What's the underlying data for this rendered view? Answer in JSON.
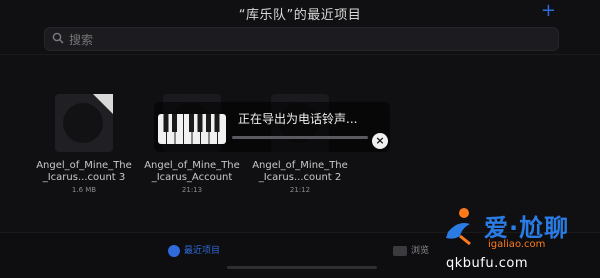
{
  "header": {
    "title": "“库乐队”的最近项目",
    "add_label": "+"
  },
  "search": {
    "placeholder": "搜索"
  },
  "files": [
    {
      "name": "Angel_of_Mine_The_Icarus...count 3",
      "meta": "1.6 MB"
    },
    {
      "name": "Angel_of_Mine_The_Icarus_Account",
      "meta": "21:13"
    },
    {
      "name": "Angel_of_Mine_The_Icarus...count 2",
      "meta": "21:12"
    }
  ],
  "overlay": {
    "message": "正在导出为电话铃声...",
    "close_label": "×"
  },
  "tabbar": {
    "recent_label": "最近项目",
    "browse_label": "浏览"
  },
  "watermark": {
    "brand": "爱·尬聊",
    "site_cn": "igaliao.com",
    "site_en": "qkbufu.com"
  },
  "colors": {
    "accent": "#2f6bdc",
    "background": "#101012"
  },
  "icons": {
    "search": "search-icon",
    "close": "close-icon",
    "recent_tab": "clock-icon",
    "browse_tab": "folder-icon"
  }
}
